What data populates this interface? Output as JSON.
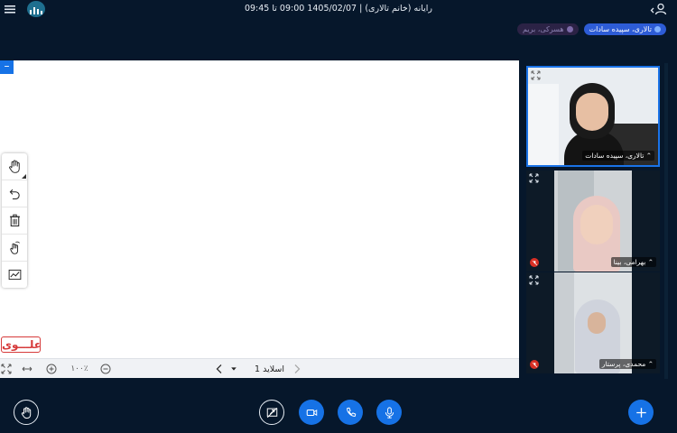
{
  "header": {
    "title": "رایانه (خانم تالاری) | 1405/02/07 09:00 تا 09:45"
  },
  "chips": {
    "presenter": "تالاری، سپیده سادات",
    "muted": "هسرکی، بریم"
  },
  "board": {
    "stamp_text": "علـــوی",
    "zoom_label": "۱۰۰٪",
    "slide_label": "اسلاید 1"
  },
  "videos": [
    {
      "name": "تالاری، سپیده سادات",
      "mic": "on",
      "active": true
    },
    {
      "name": "بهرامی، بینا",
      "mic": "off",
      "active": false
    },
    {
      "name": "محمدی، پرستار",
      "mic": "off",
      "active": false
    }
  ],
  "icons": {
    "topbar": [
      "menu-icon",
      "app-logo-icon",
      "user-icon"
    ],
    "tools": [
      "hand-icon",
      "undo-icon",
      "trash-icon",
      "multi-touch-icon",
      "pen-line-icon"
    ],
    "footer": [
      "fit-screen-icon",
      "fit-width-icon",
      "zoom-in-icon",
      "zoom-out-icon",
      "prev-slide-icon",
      "next-slide-icon"
    ],
    "controls": [
      "raise-hand-icon",
      "screen-share-off-icon",
      "video-icon",
      "phone-icon",
      "microphone-icon",
      "plus-icon"
    ]
  },
  "colors": {
    "background": "#06172b",
    "accent": "#1672e6",
    "presenter_chip": "#2d5cd6",
    "stamp": "#d63a3a",
    "mic_off": "#d93025"
  }
}
